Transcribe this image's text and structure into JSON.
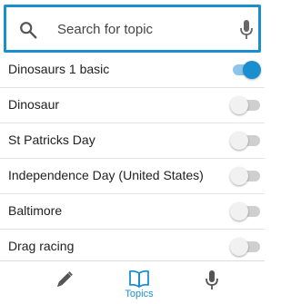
{
  "search": {
    "placeholder": "Search for topic",
    "value": "",
    "icon": "search-icon",
    "mic_icon": "microphone-icon"
  },
  "colors": {
    "accent": "#1a8fcf",
    "toggle_off_track": "#cfcfcf",
    "toggle_off_thumb": "#f1f1f1",
    "text": "#212121"
  },
  "topics": [
    {
      "label": "Dinosaurs 1 basic",
      "enabled": true
    },
    {
      "label": "Dinosaur",
      "enabled": false
    },
    {
      "label": "St Patricks Day",
      "enabled": false
    },
    {
      "label": "Independence Day (United States)",
      "enabled": false
    },
    {
      "label": "Baltimore",
      "enabled": false
    },
    {
      "label": "Drag racing",
      "enabled": false
    }
  ],
  "bottom_nav": {
    "items": [
      {
        "icon": "pencil-icon",
        "label": "",
        "active": false
      },
      {
        "icon": "book-icon",
        "label": "Topics",
        "active": true
      },
      {
        "icon": "microphone-icon",
        "label": "",
        "active": false
      }
    ]
  }
}
